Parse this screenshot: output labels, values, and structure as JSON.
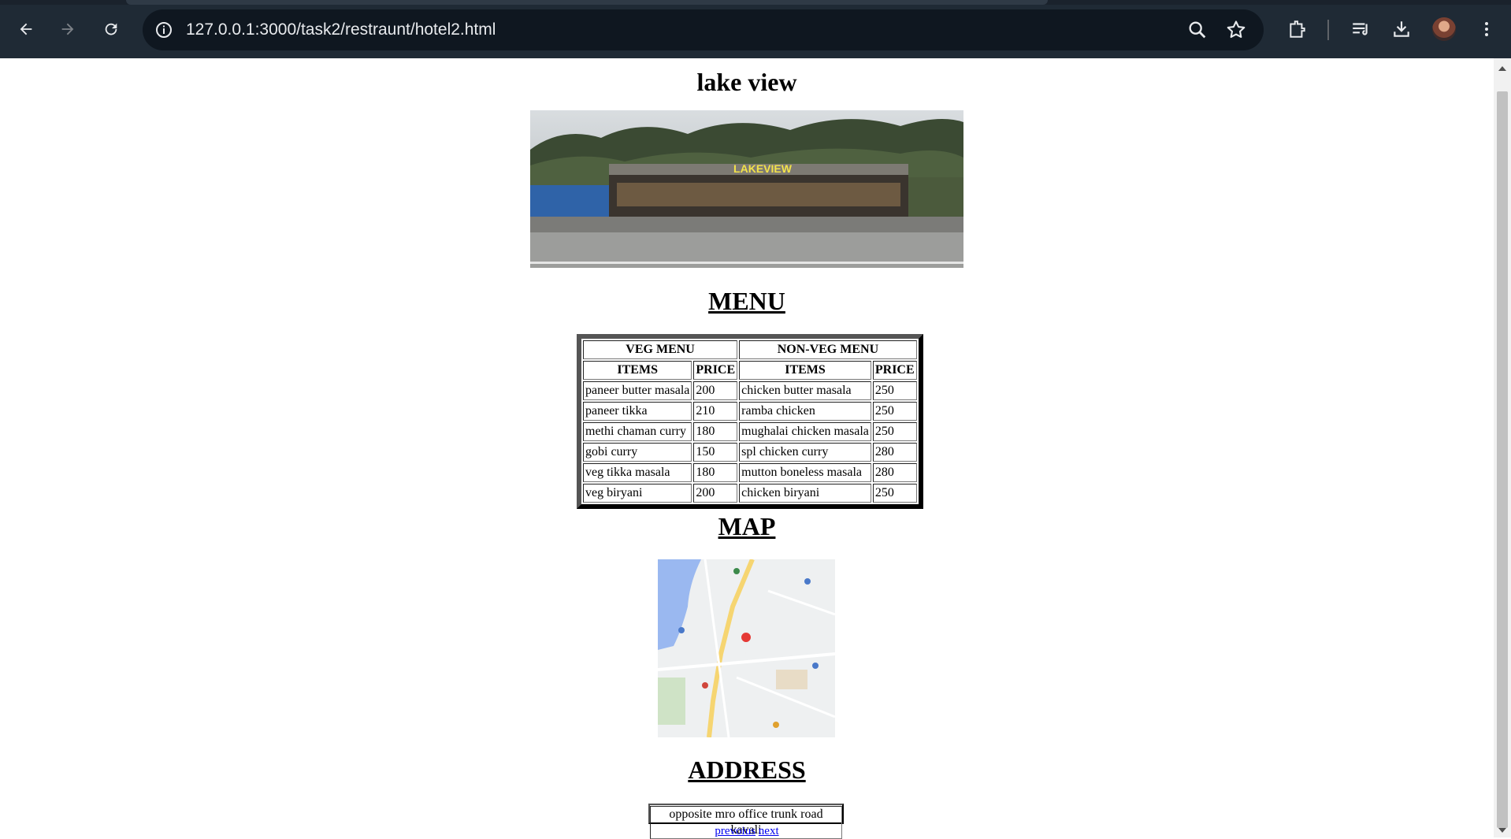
{
  "browser": {
    "url": "127.0.0.1:3000/task2/restraunt/hotel2.html",
    "icons": [
      "back-arrow-icon",
      "forward-arrow-icon",
      "reload-icon",
      "site-info-icon",
      "zoom-icon",
      "bookmark-star-icon",
      "extensions-icon",
      "reading-list-icon",
      "download-icon",
      "profile-avatar",
      "kebab-menu-icon"
    ]
  },
  "page": {
    "title": "lake view",
    "photo_sign": "LAKEVIEW",
    "menu_heading": "MENU",
    "map_heading": "MAP",
    "address_heading": "ADDRESS",
    "address": "opposite mro office trunk road kavali",
    "links": {
      "previous": "prevoius",
      "next": "next"
    }
  },
  "menu": {
    "veg_header": "VEG MENU",
    "nonveg_header": "NON-VEG MENU",
    "col_items": "ITEMS",
    "col_price": "PRICE",
    "rows": [
      {
        "veg": "paneer butter masala",
        "veg_price": "200",
        "nonveg": "chicken butter masala",
        "nonveg_price": "250"
      },
      {
        "veg": "paneer tikka",
        "veg_price": "210",
        "nonveg": "ramba chicken",
        "nonveg_price": "250"
      },
      {
        "veg": "methi chaman curry",
        "veg_price": "180",
        "nonveg": "mughalai chicken masala",
        "nonveg_price": "250"
      },
      {
        "veg": "gobi curry",
        "veg_price": "150",
        "nonveg": "spl chicken curry",
        "nonveg_price": "280"
      },
      {
        "veg": "veg tikka masala",
        "veg_price": "180",
        "nonveg": "mutton boneless masala",
        "nonveg_price": "280"
      },
      {
        "veg": "veg biryani",
        "veg_price": "200",
        "nonveg": "chicken biryani",
        "nonveg_price": "250"
      }
    ]
  },
  "colors": {
    "chrome": "#1f2a35",
    "omnibox": "#0f1720",
    "link": "#0000ee",
    "map_water": "#9ab8f0"
  }
}
